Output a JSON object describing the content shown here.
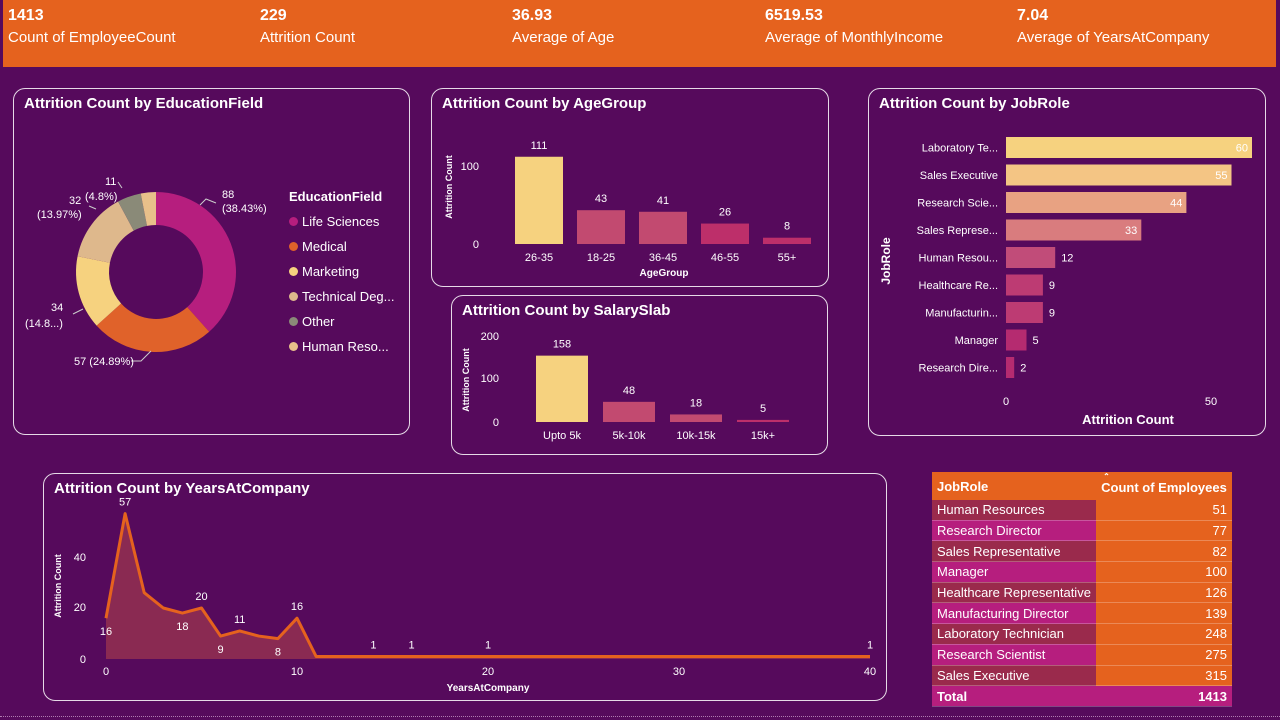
{
  "kpis": [
    {
      "value": "1413",
      "label": "Count of EmployeeCount"
    },
    {
      "value": "229",
      "label": "Attrition Count"
    },
    {
      "value": "36.93",
      "label": "Average of Age"
    },
    {
      "value": "6519.53",
      "label": "Average of MonthlyIncome"
    },
    {
      "value": "7.04",
      "label": "Average of YearsAtCompany"
    }
  ],
  "education": {
    "title": "Attrition Count by EducationField",
    "legend_title": "EducationField",
    "legend": [
      {
        "label": "Life Sciences",
        "color": "#b61e7e"
      },
      {
        "label": "Medical",
        "color": "#e0622a"
      },
      {
        "label": "Marketing",
        "color": "#f6d27f"
      },
      {
        "label": "Technical Deg...",
        "color": "#deb88c"
      },
      {
        "label": "Other",
        "color": "#8a8a78"
      },
      {
        "label": "Human Reso...",
        "color": "#e8c08a"
      }
    ],
    "labels": {
      "life": "88",
      "life_pct": "(38.43%)",
      "medical": "57 (24.89%)",
      "marketing": "34",
      "marketing_pct": "(14.8...)",
      "technical": "32",
      "technical_pct": "(13.97%)",
      "other": "11",
      "other_pct": "(4.8%)"
    }
  },
  "age": {
    "title": "Attrition Count by AgeGroup",
    "ylabel": "Attrition Count",
    "xlabel": "AgeGroup",
    "ticks": [
      "100",
      "0"
    ]
  },
  "salary": {
    "title": "Attrition Count by SalarySlab",
    "ylabel": "Attrition Count",
    "ticks": [
      "200",
      "100",
      "0"
    ]
  },
  "jobrole": {
    "title": "Attrition Count by JobRole",
    "ylabel": "JobRole",
    "xlabel": "Attrition Count",
    "ticks": [
      "0",
      "50"
    ]
  },
  "years": {
    "title": "Attrition Count by YearsAtCompany",
    "ylabel": "Attrition Count",
    "xlabel": "YearsAtCompany",
    "yticks": [
      "40",
      "20",
      "0"
    ],
    "xticks": [
      "0",
      "10",
      "20",
      "30",
      "40"
    ]
  },
  "table": {
    "header_role": "JobRole",
    "header_count": "Count of Employees",
    "rows": [
      {
        "role": "Human Resources",
        "count": "51"
      },
      {
        "role": "Research Director",
        "count": "77"
      },
      {
        "role": "Sales Representative",
        "count": "82"
      },
      {
        "role": "Manager",
        "count": "100"
      },
      {
        "role": "Healthcare Representative",
        "count": "126"
      },
      {
        "role": "Manufacturing Director",
        "count": "139"
      },
      {
        "role": "Laboratory Technician",
        "count": "248"
      },
      {
        "role": "Research Scientist",
        "count": "275"
      },
      {
        "role": "Sales Executive",
        "count": "315"
      }
    ],
    "total_label": "Total",
    "total_value": "1413"
  },
  "chart_data": [
    {
      "type": "pie",
      "title": "Attrition Count by EducationField",
      "categories": [
        "Life Sciences",
        "Medical",
        "Marketing",
        "Technical Degree",
        "Other",
        "Human Resources"
      ],
      "values": [
        88,
        57,
        34,
        32,
        11,
        7
      ]
    },
    {
      "type": "bar",
      "title": "Attrition Count by AgeGroup",
      "categories": [
        "26-35",
        "18-25",
        "36-45",
        "46-55",
        "55+"
      ],
      "values": [
        111,
        43,
        41,
        26,
        8
      ],
      "xlabel": "AgeGroup",
      "ylabel": "Attrition Count",
      "ylim": [
        0,
        130
      ]
    },
    {
      "type": "bar",
      "title": "Attrition Count by SalarySlab",
      "categories": [
        "Upto 5k",
        "5k-10k",
        "10k-15k",
        "15k+"
      ],
      "values": [
        158,
        48,
        18,
        5
      ],
      "xlabel": "",
      "ylabel": "Attrition Count",
      "ylim": [
        0,
        200
      ]
    },
    {
      "type": "bar",
      "title": "Attrition Count by JobRole",
      "categories": [
        "Laboratory Te...",
        "Sales Executive",
        "Research Scie...",
        "Sales Represe...",
        "Human Resou...",
        "Healthcare Re...",
        "Manufacturin...",
        "Manager",
        "Research Dire..."
      ],
      "values": [
        60,
        55,
        44,
        33,
        12,
        9,
        9,
        5,
        2
      ],
      "xlabel": "Attrition Count",
      "ylabel": "JobRole",
      "xlim": [
        0,
        60
      ]
    },
    {
      "type": "area",
      "title": "Attrition Count by YearsAtCompany",
      "x": [
        0,
        1,
        2,
        3,
        4,
        5,
        6,
        7,
        8,
        9,
        10,
        11,
        12,
        13,
        14,
        15,
        16,
        17,
        18,
        19,
        20,
        21,
        22,
        23,
        24,
        25,
        26,
        27,
        28,
        29,
        30,
        31,
        32,
        33,
        34,
        35,
        36,
        37,
        38,
        39,
        40
      ],
      "values": [
        16,
        57,
        26,
        20,
        18,
        20,
        9,
        11,
        9,
        8,
        16,
        1,
        1,
        1,
        1,
        1,
        1,
        1,
        1,
        1,
        1,
        1,
        1,
        1,
        1,
        1,
        1,
        1,
        1,
        1,
        1,
        1,
        1,
        1,
        1,
        1,
        1,
        1,
        1,
        1,
        1
      ],
      "labeled_points": [
        0,
        1,
        4,
        5,
        6,
        7,
        9,
        10,
        14,
        16,
        20,
        40
      ],
      "xlabel": "YearsAtCompany",
      "ylabel": "Attrition Count",
      "xlim": [
        0,
        40
      ],
      "ylim": [
        0,
        60
      ]
    }
  ]
}
